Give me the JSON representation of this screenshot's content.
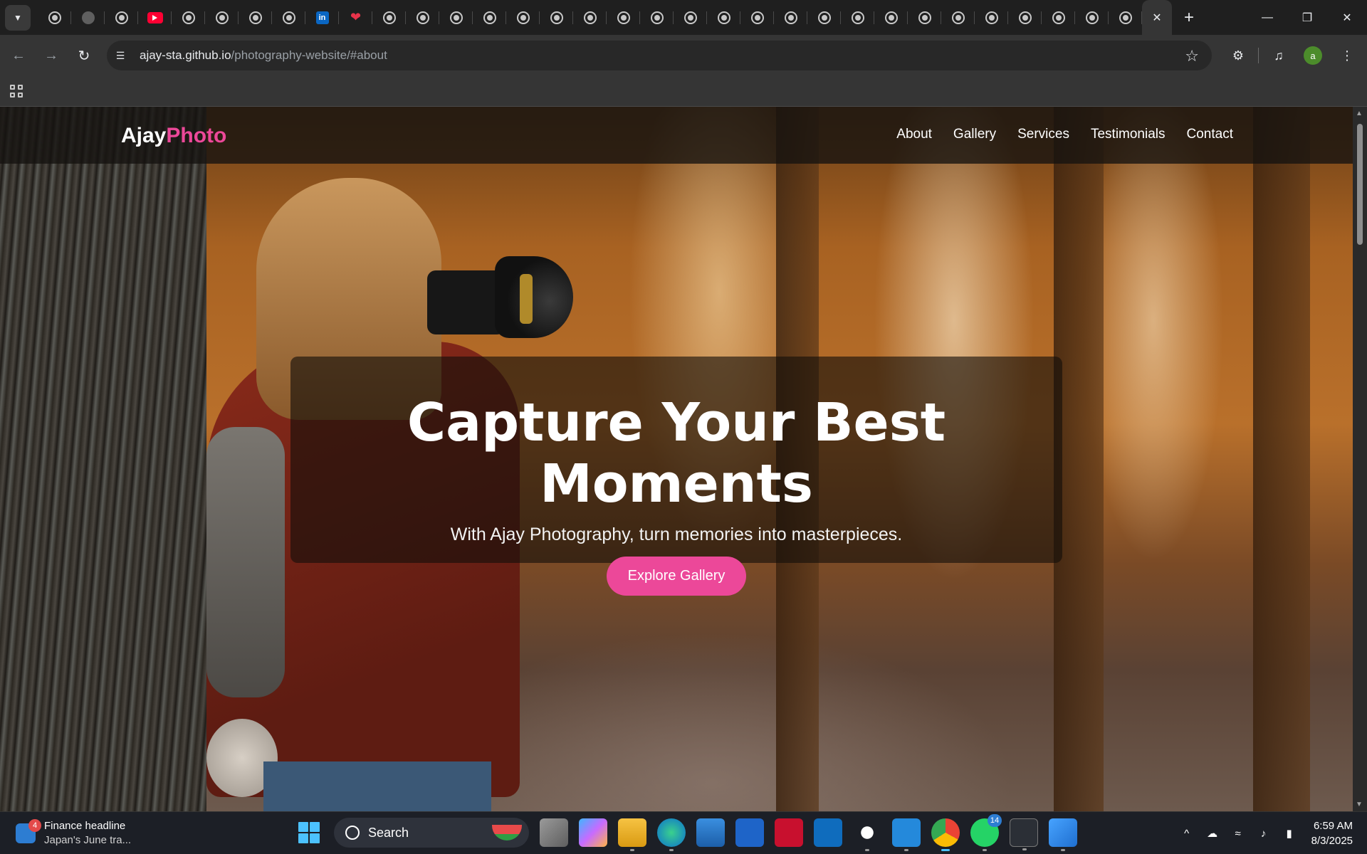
{
  "browser": {
    "url_host": "ajay-sta.github.io",
    "url_path": "/photography-website/#about",
    "tabs": [
      {
        "favicon": "globe-icon"
      },
      {
        "favicon": "github-icon"
      },
      {
        "favicon": "globe-icon"
      },
      {
        "favicon": "youtube-icon"
      },
      {
        "favicon": "globe-icon"
      },
      {
        "favicon": "globe-icon"
      },
      {
        "favicon": "globe-icon"
      },
      {
        "favicon": "globe-icon"
      },
      {
        "favicon": "linkedin-icon"
      },
      {
        "favicon": "heart-icon"
      },
      {
        "favicon": "globe-icon"
      },
      {
        "favicon": "globe-icon"
      },
      {
        "favicon": "globe-icon"
      },
      {
        "favicon": "globe-icon"
      },
      {
        "favicon": "globe-icon"
      },
      {
        "favicon": "globe-icon"
      },
      {
        "favicon": "globe-icon"
      },
      {
        "favicon": "globe-icon"
      },
      {
        "favicon": "globe-icon"
      },
      {
        "favicon": "globe-icon"
      },
      {
        "favicon": "globe-icon"
      },
      {
        "favicon": "globe-icon"
      },
      {
        "favicon": "globe-icon"
      },
      {
        "favicon": "globe-icon"
      },
      {
        "favicon": "globe-icon"
      },
      {
        "favicon": "globe-icon"
      },
      {
        "favicon": "globe-icon"
      },
      {
        "favicon": "globe-icon"
      },
      {
        "favicon": "globe-icon"
      },
      {
        "favicon": "globe-icon"
      },
      {
        "favicon": "globe-icon"
      },
      {
        "favicon": "globe-icon"
      },
      {
        "favicon": "globe-icon"
      }
    ],
    "active_tab_icon": "close-icon",
    "profile_initial": "a"
  },
  "site": {
    "logo_main": "Ajay",
    "logo_accent": "Photo",
    "nav": [
      "About",
      "Gallery",
      "Services",
      "Testimonials",
      "Contact"
    ],
    "hero_title": "Capture Your Best Moments",
    "hero_subtitle": "With Ajay Photography, turn memories into masterpieces.",
    "hero_button": "Explore Gallery",
    "accent_color": "#ec4899"
  },
  "taskbar": {
    "widget_badge": "4",
    "widget_title": "Finance headline",
    "widget_sub": "Japan's June tra...",
    "search_label": "Search",
    "whatsapp_badge": "14",
    "time": "6:59 AM",
    "date": "8/3/2025"
  }
}
